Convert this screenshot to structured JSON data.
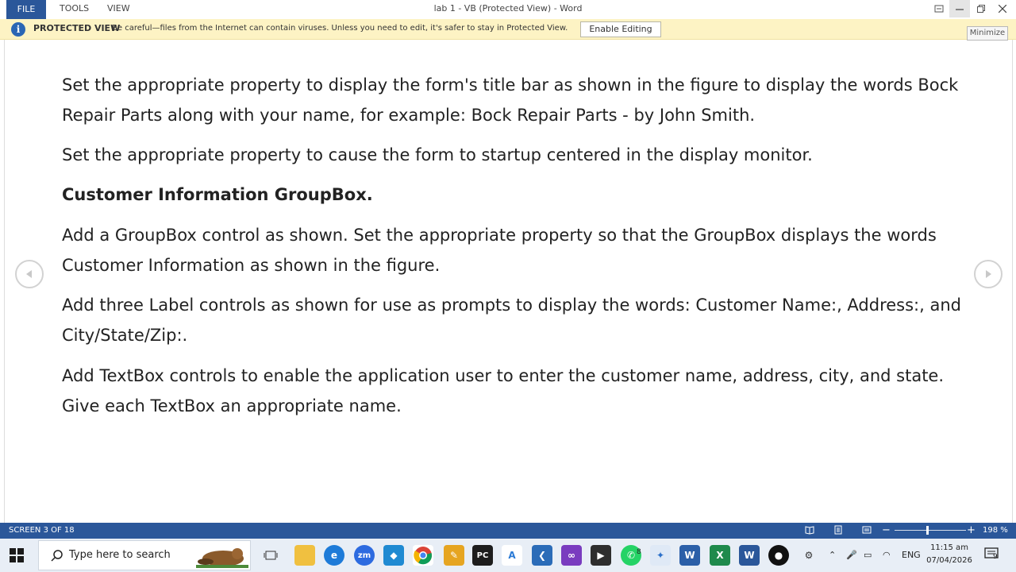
{
  "titlebar": {
    "menu": [
      "FILE",
      "TOOLS",
      "VIEW"
    ],
    "window_title": "lab 1 - VB (Protected View) - Word",
    "tooltip": "Minimize"
  },
  "protected_view": {
    "title": "PROTECTED VIEW",
    "message": "Be careful—files from the Internet can contain viruses. Unless you need to edit, it's safer to stay in Protected View.",
    "button": "Enable Editing"
  },
  "document": {
    "paragraphs": [
      "Set the appropriate property to display the form's title bar as shown in the figure to display the words Bock Repair Parts along with your name, for example: Bock Repair Parts - by John Smith.",
      "Set the appropriate property to cause the form to startup centered in the display monitor.",
      "Customer Information GroupBox.",
      "Add a GroupBox control as shown.  Set the appropriate property so that the GroupBox displays the words Customer Information as shown in the figure.",
      "Add three Label controls as shown for use as prompts to display the words:  Customer Name:, Address:, and City/State/Zip:.",
      "Add TextBox controls to enable the application user to enter the customer name, address, city, and state.  Give each TextBox an appropriate name."
    ]
  },
  "statusbar": {
    "screen": "SCREEN 3 OF 18",
    "zoom": "198 %",
    "zoom_percent": 198
  },
  "taskbar": {
    "search_placeholder": "Type here to search",
    "language": "ENG",
    "time": "11:15 am",
    "date": "07/04/2026",
    "badges": {
      "whatsapp": "8",
      "notifications": "9"
    }
  },
  "colors": {
    "word_blue": "#2b579a",
    "protected_bar": "#fdf3c4",
    "taskbar": "#e8eef6"
  }
}
